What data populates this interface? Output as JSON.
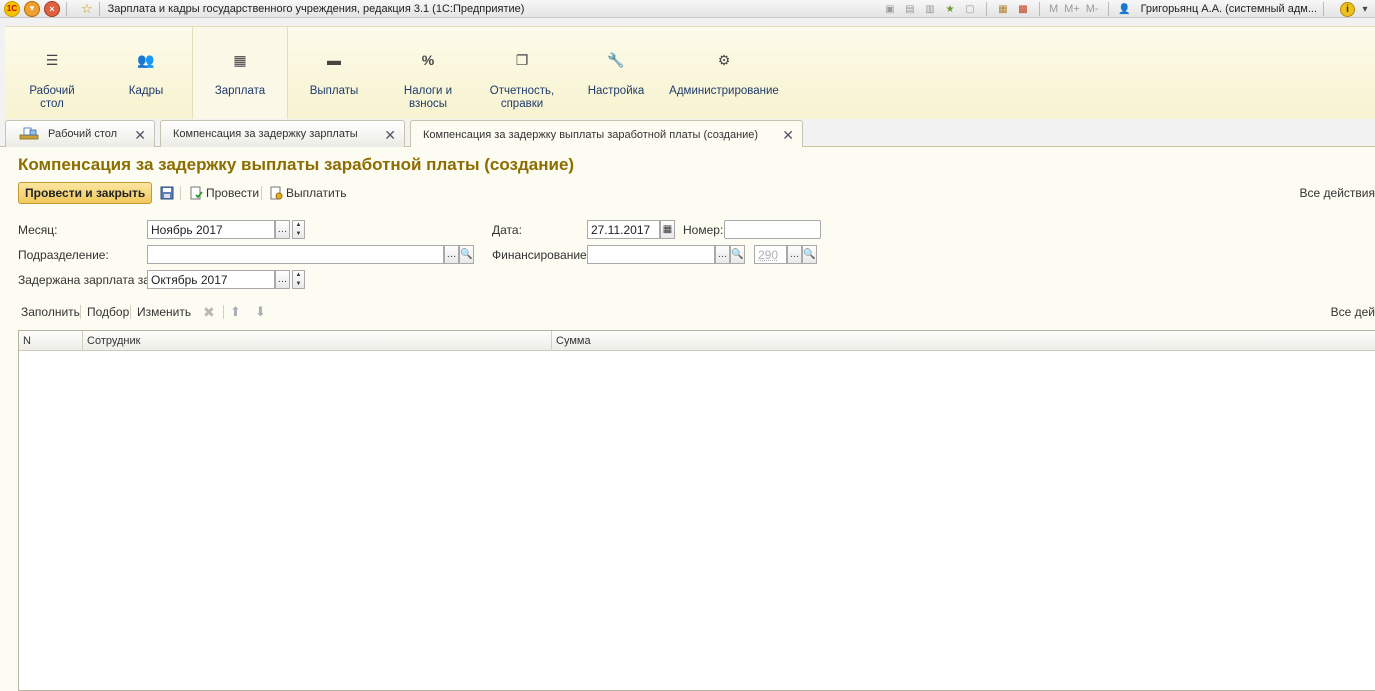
{
  "titlebar": {
    "title": "Зарплата и кадры государственного учреждения, редакция 3.1  (1С:Предприятие)",
    "logo": "1С",
    "memory_buttons": [
      "M",
      "M+",
      "M-"
    ],
    "user": "Григорьянц А.А. (системный адм...",
    "info": "i"
  },
  "sections": [
    {
      "label": "Рабочий\nстол",
      "icon": "menu-icon"
    },
    {
      "label": "Кадры",
      "icon": "people-icon"
    },
    {
      "label": "Зарплата",
      "icon": "calculator-icon"
    },
    {
      "label": "Выплаты",
      "icon": "wallet-icon"
    },
    {
      "label": "Налоги и\nвзносы",
      "icon": "percent-icon"
    },
    {
      "label": "Отчетность,\nсправки",
      "icon": "documents-icon"
    },
    {
      "label": "Настройка",
      "icon": "wrench-icon"
    },
    {
      "label": "Администрирование",
      "icon": "gear-icon"
    }
  ],
  "active_section": "Зарплата",
  "tabs": [
    {
      "label": "Рабочий стол"
    },
    {
      "label": "Компенсация за задержку зарплаты"
    },
    {
      "label": "Компенсация за задержку выплаты заработной платы (создание)"
    }
  ],
  "form": {
    "title": "Компенсация за задержку выплаты заработной платы (создание)",
    "commands": {
      "post_and_close": "Провести и закрыть",
      "post": "Провести",
      "pay": "Выплатить",
      "all_actions": "Все действия"
    },
    "fields": {
      "month_label": "Месяц:",
      "month_value": "Ноябрь 2017",
      "department_label": "Подразделение:",
      "department_value": "",
      "delayed_salary_label": "Задержана зарплата за:",
      "delayed_salary_value": "Октябрь 2017",
      "date_label": "Дата:",
      "date_value": "27.11.2017",
      "number_label": "Номер:",
      "number_value": "",
      "financing_label": "Финансирование:",
      "financing_value": "",
      "article_placeholder": "290"
    },
    "table_commands": {
      "fill": "Заполнить",
      "pick": "Подбор",
      "change": "Изменить",
      "all_actions": "Все дей"
    },
    "table": {
      "columns": [
        "N",
        "Сотрудник",
        "Сумма"
      ],
      "rows": []
    }
  }
}
